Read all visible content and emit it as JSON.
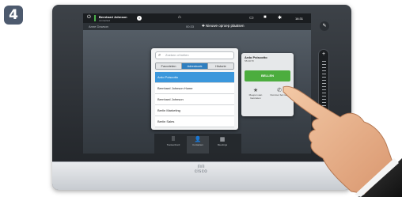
{
  "step_number": "4",
  "statusbar": {
    "caller_name": "Bernhard Johnson",
    "caller_sub": "connected",
    "time": "16:31",
    "icons": [
      "power-icon",
      "info-icon",
      "home-icon",
      "layout-icon",
      "camera-icon",
      "settings-icon"
    ]
  },
  "subbar": {
    "participant": "Anne Dowson",
    "duration": "00:33",
    "add_call_label": "Nieuwe oproep plaatsen"
  },
  "dialog": {
    "search_placeholder": "Zoeken of bellen",
    "tabs": [
      {
        "label": "Favorieten",
        "active": false
      },
      {
        "label": "Adresboek",
        "active": true
      },
      {
        "label": "Historie",
        "active": false
      }
    ],
    "items": [
      {
        "label": "Ardo Poiscotto",
        "selected": true
      },
      {
        "label": "Bernhard Johnson Home",
        "selected": false
      },
      {
        "label": "Bernhard Johnson",
        "selected": false
      },
      {
        "label": "Berlin Marketing",
        "selected": false
      },
      {
        "label": "Berlin Sales",
        "selected": false
      }
    ]
  },
  "card": {
    "name": "Ardo Poiscotto",
    "number": "5844078",
    "call_label": "BELLEN",
    "fav_label": "Meepen aan favorieten",
    "other_label": "Nummer bel naar"
  },
  "bottombar": {
    "items": [
      {
        "label": "Toetsenbord",
        "icon": "keypad-icon"
      },
      {
        "label": "Contacten",
        "icon": "contacts-icon",
        "active": true
      },
      {
        "label": "Meetings",
        "icon": "calendar-icon"
      }
    ]
  },
  "brand": "cisco"
}
